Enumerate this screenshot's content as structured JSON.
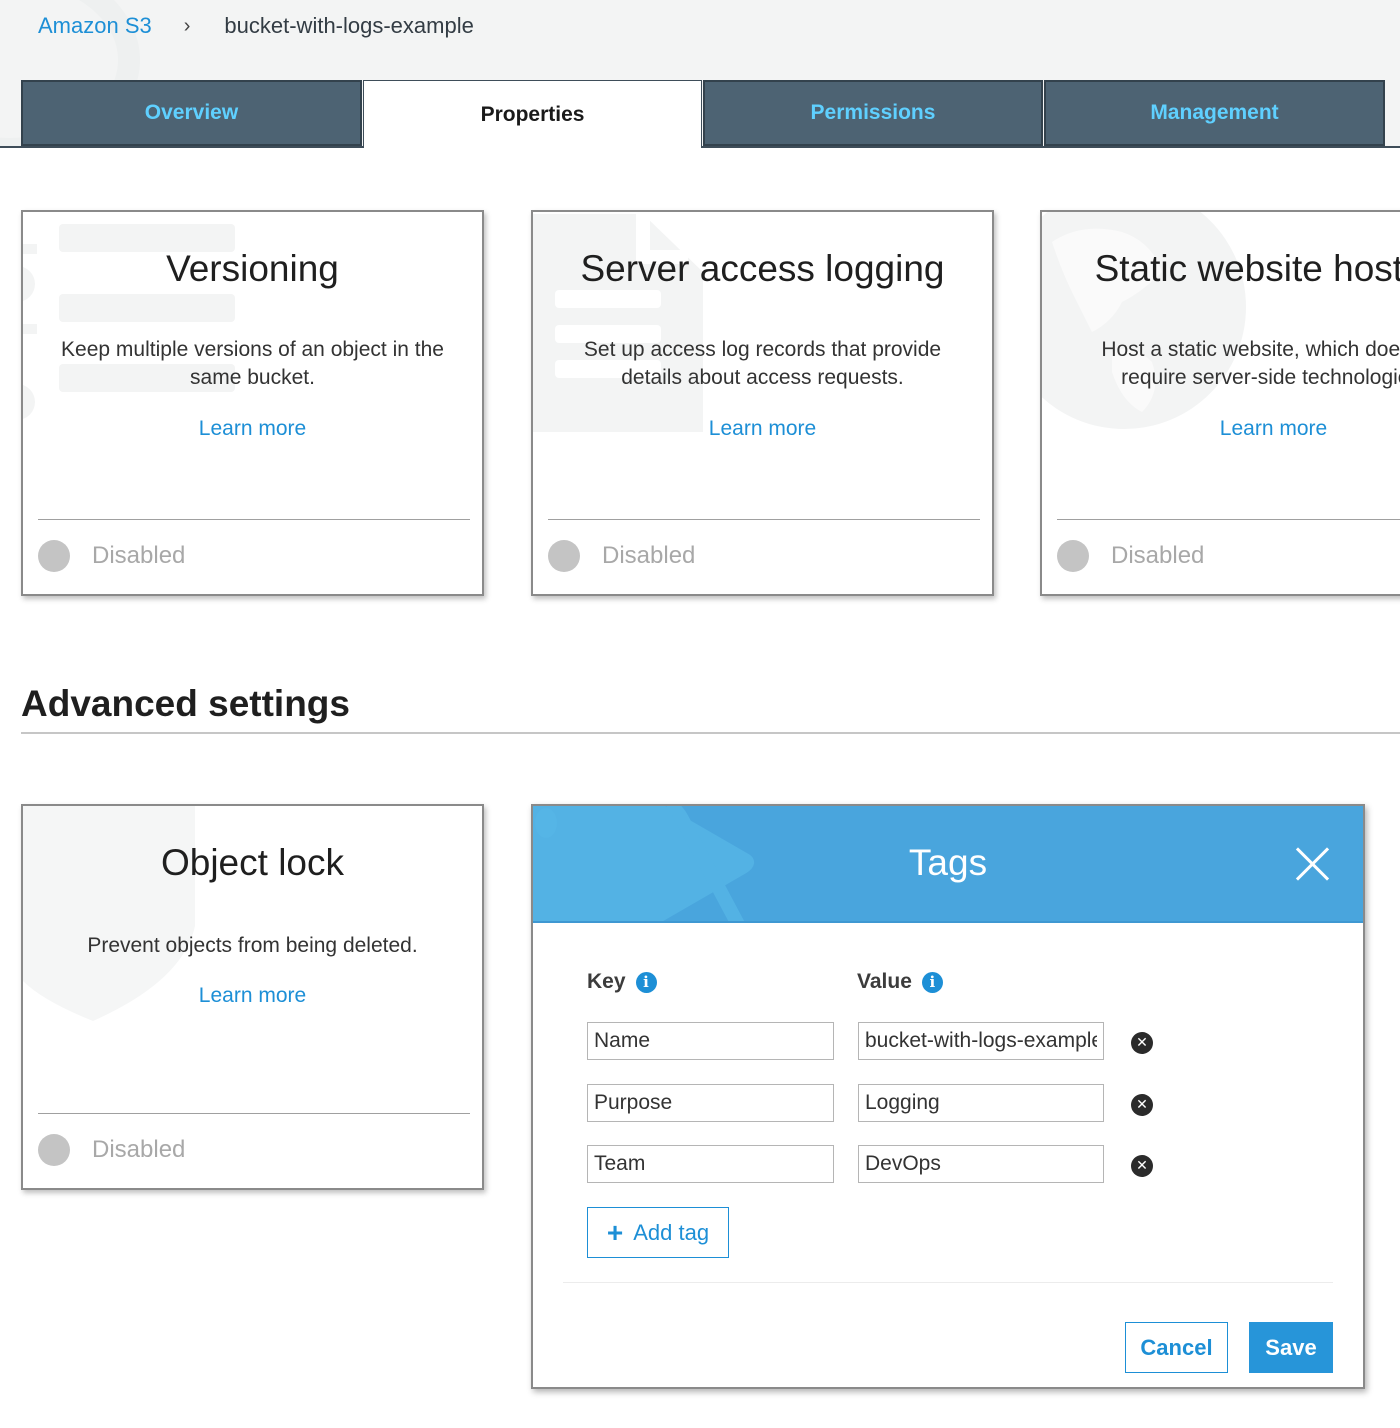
{
  "breadcrumb": {
    "root": "Amazon S3",
    "separator": "›",
    "current": "bucket-with-logs-example"
  },
  "tabs": [
    {
      "label": "Overview",
      "active": false
    },
    {
      "label": "Properties",
      "active": true
    },
    {
      "label": "Permissions",
      "active": false
    },
    {
      "label": "Management",
      "active": false
    }
  ],
  "cards": {
    "versioning": {
      "title": "Versioning",
      "description": "Keep multiple versions of an object in the same bucket.",
      "link": "Learn more",
      "status": "Disabled"
    },
    "logging": {
      "title": "Server access logging",
      "description": "Set up access log records that provide details about access requests.",
      "link": "Learn more",
      "status": "Disabled"
    },
    "static_website": {
      "title": "Static website hosting",
      "description_line1": "Host a static website, which does not",
      "description_line2": "require server-side technologies.",
      "link": "Learn more",
      "status": "Disabled"
    },
    "object_lock": {
      "title": "Object lock",
      "description": "Prevent objects from being deleted.",
      "link": "Learn more",
      "status": "Disabled"
    }
  },
  "advanced": {
    "title": "Advanced settings"
  },
  "tags_panel": {
    "title": "Tags",
    "key_label": "Key",
    "value_label": "Value",
    "info_glyph": "i",
    "remove_glyph": "✕",
    "rows": [
      {
        "key": "Name",
        "value": "bucket-with-logs-example"
      },
      {
        "key": "Purpose",
        "value": "Logging"
      },
      {
        "key": "Team",
        "value": "DevOps"
      }
    ],
    "add_tag_label": "Add tag",
    "add_tag_glyph": "+",
    "cancel_label": "Cancel",
    "save_label": "Save"
  },
  "colors": {
    "accent": "#1d8fd6",
    "tab_bg": "#4d6373",
    "tab_text": "#5fd0ff",
    "modal_header": "#49a5dd",
    "save_button": "#2795d9",
    "disabled_dot": "#c4c4c4"
  }
}
